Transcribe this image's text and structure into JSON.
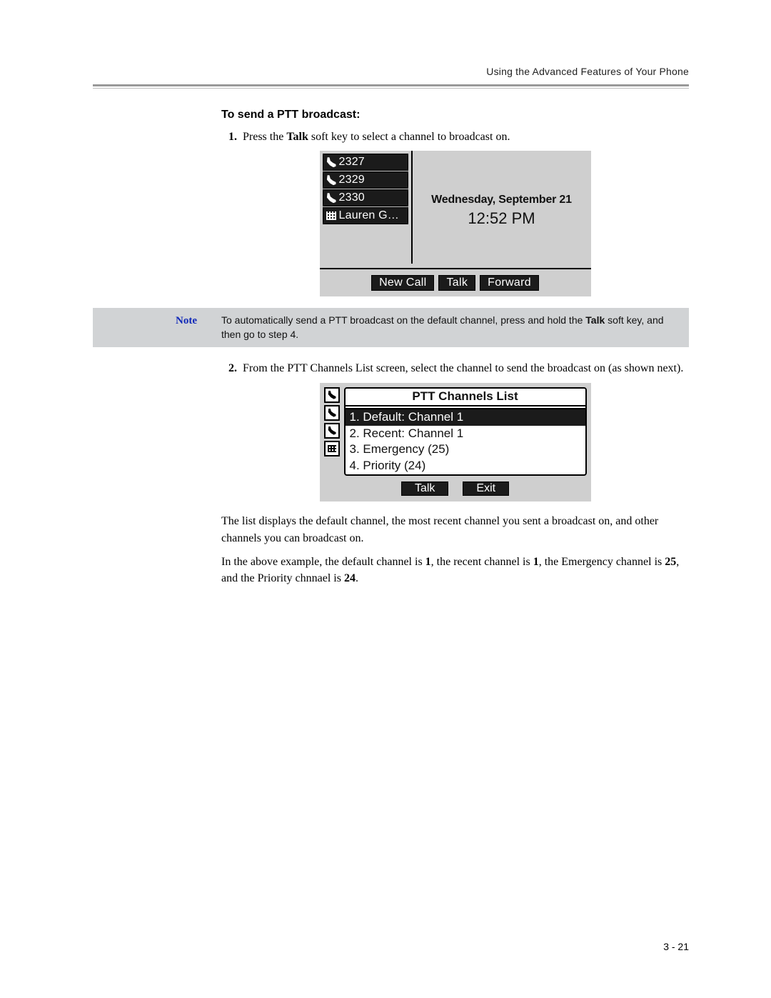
{
  "header": {
    "chapter_title": "Using the Advanced Features of Your Phone"
  },
  "section": {
    "title": "To send a PTT broadcast:"
  },
  "steps": {
    "s1": {
      "num": "1.",
      "before": "Press the ",
      "bold": "Talk",
      "after": " soft key to select a channel to broadcast on."
    },
    "s2": {
      "num": "2.",
      "text": "From the PTT Channels List screen, select the channel to send the broadcast on (as shown next)."
    }
  },
  "fig1": {
    "lines": {
      "l0": "2327",
      "l1": "2329",
      "l2": "2330",
      "l3": "Lauren G…"
    },
    "date": "Wednesday, September 21",
    "time": "12:52 PM",
    "softkeys": {
      "k0": "New Call",
      "k1": "Talk",
      "k2": "Forward"
    }
  },
  "note": {
    "label": "Note",
    "before": "To automatically send a PTT broadcast on the default channel, press and hold the ",
    "bold": "Talk",
    "after": " soft key, and then go to step 4."
  },
  "fig2": {
    "title": "PTT Channels List",
    "items": {
      "i0": "1. Default: Channel 1",
      "i1": "2. Recent: Channel 1",
      "i2": "3. Emergency (25)",
      "i3": "4. Priority (24)"
    },
    "softkeys": {
      "k0": "Talk",
      "k1": "Exit"
    }
  },
  "after_list_para": "The list displays the default channel, the most recent channel you sent a broadcast on, and other channels you can broadcast on.",
  "example_para": {
    "p1": "In the above example, the default channel is ",
    "b1": "1",
    "p2": ", the recent channel is ",
    "b2": "1",
    "p3": ", the Emergency channel is ",
    "b3": "25",
    "p4": ", and the Priority chnnael is ",
    "b4": "24",
    "p5": "."
  },
  "page_number": "3 - 21"
}
